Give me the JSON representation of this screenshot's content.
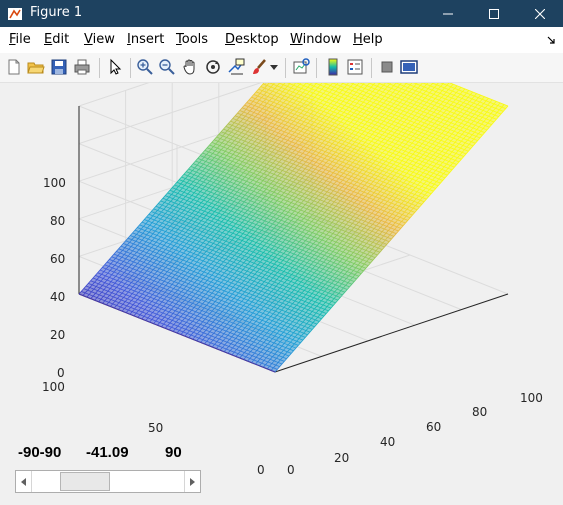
{
  "window": {
    "title": "Figure 1"
  },
  "menu": [
    "File",
    "Edit",
    "View",
    "Insert",
    "Tools",
    "Desktop",
    "Window",
    "Help"
  ],
  "menu_access_keys": [
    "F",
    "E",
    "V",
    "I",
    "T",
    "D",
    "W",
    "H"
  ],
  "toolbar": {
    "tools": [
      "new-figure",
      "open-file",
      "save",
      "print",
      "select",
      "zoom-in",
      "zoom-out",
      "pan",
      "rotate-3d",
      "data-cursor",
      "brush",
      "link-plot",
      "colorbar",
      "legend",
      "hide-plot-tools",
      "show-plot-tools"
    ]
  },
  "axes": {
    "z_ticks": [
      "0",
      "20",
      "40",
      "60",
      "80",
      "100"
    ],
    "x_ticks": [
      "0",
      "20",
      "40",
      "60",
      "80",
      "100"
    ],
    "y_ticks": [
      "0",
      "50",
      "100"
    ]
  },
  "chart_data": {
    "type": "surface",
    "x_range": [
      0,
      100
    ],
    "y_range": [
      0,
      100
    ],
    "zlim": [
      0,
      100
    ],
    "surface": "z = x (linear ramp rising along x, constant along y)",
    "colormap": [
      "#3e26a8",
      "#3d55d9",
      "#1d9bd6",
      "#13bcaa",
      "#7ccb5e",
      "#e9b73d",
      "#f9fb0e"
    ]
  },
  "controls": {
    "labels": [
      "-90-90",
      "-41.09",
      "90"
    ],
    "slider_value": -41.09,
    "slider_min": -90,
    "slider_max": 90
  }
}
